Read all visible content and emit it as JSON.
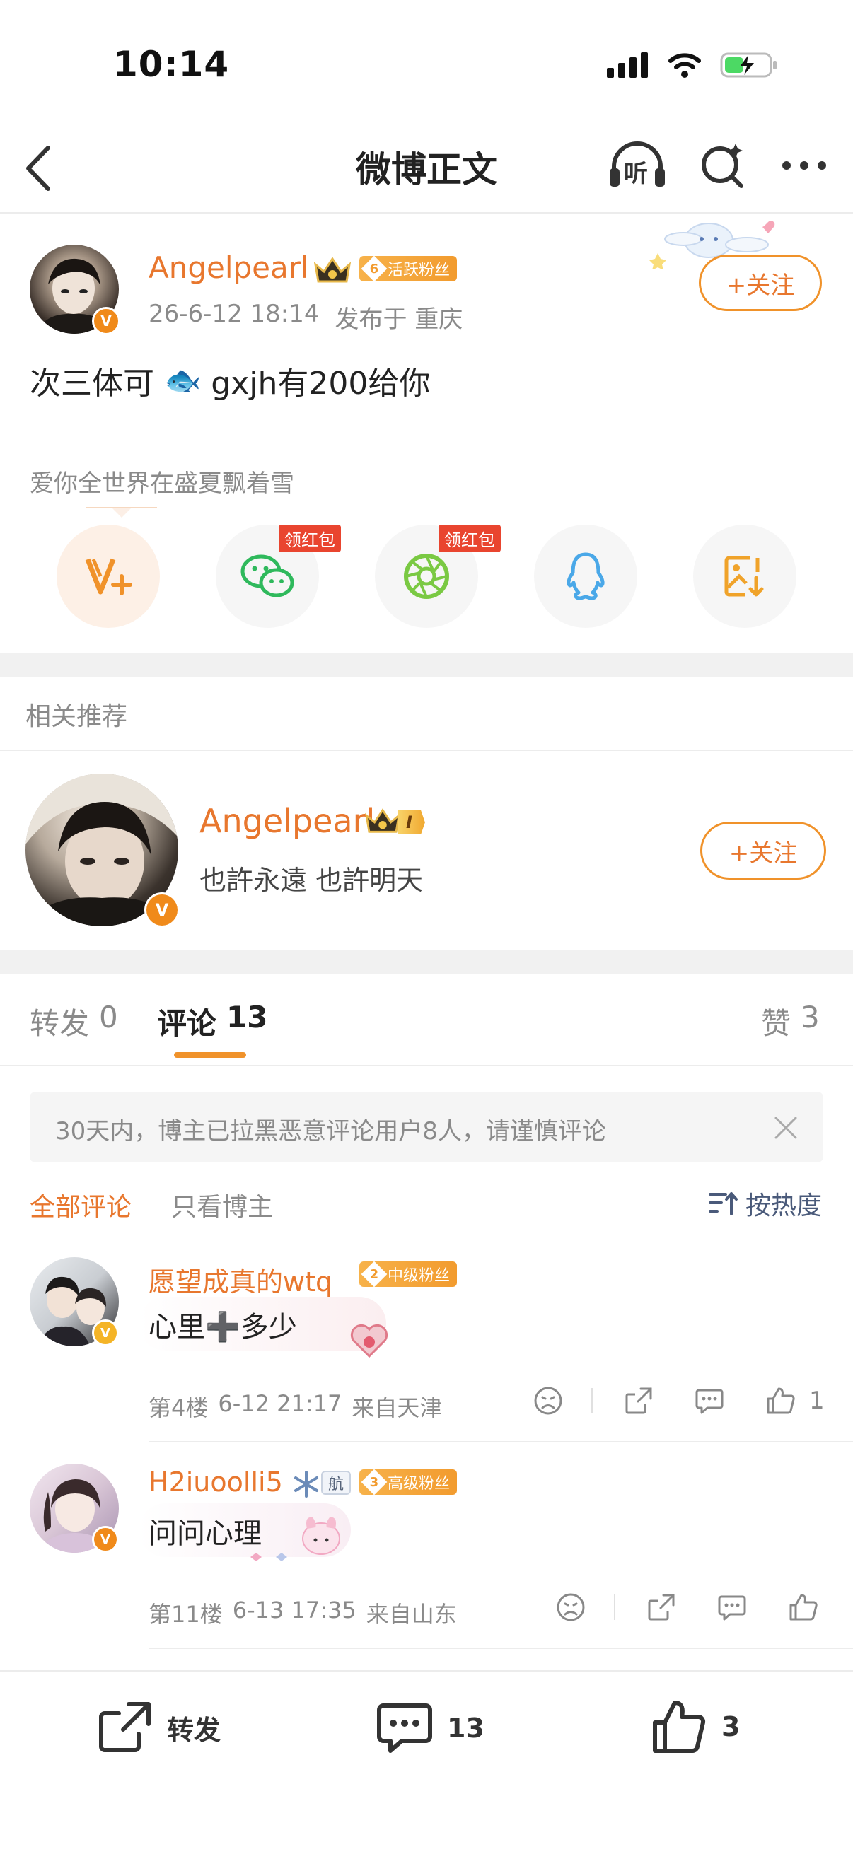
{
  "status": {
    "time": "10:14"
  },
  "nav": {
    "title": "微博正文",
    "listen_label": "听"
  },
  "post": {
    "author": "Angelpearl",
    "fan_badge_level": "6",
    "fan_badge_text": "活跃粉丝",
    "meta_time": "26-6-12 18:14",
    "meta_location": "发布于 重庆",
    "follow_label": "+关注",
    "text_before": "次三体可",
    "text_emoji": "🐟",
    "text_after": "gxjh有200给你",
    "signature": "爱你全世界在盛夏飘着雪"
  },
  "share": {
    "items": [
      {
        "name": "weibo-vplus",
        "tag": ""
      },
      {
        "name": "wechat",
        "tag": "领红包"
      },
      {
        "name": "moments",
        "tag": "领红包"
      },
      {
        "name": "qq",
        "tag": ""
      },
      {
        "name": "save-image",
        "tag": ""
      }
    ]
  },
  "recommend": {
    "section_title": "相关推荐",
    "name": "Angelpearl",
    "level": "I",
    "desc": "也許永遠 也許明天",
    "follow_label": "+关注"
  },
  "tabs": {
    "repost_label": "转发",
    "repost_count": "0",
    "comment_label": "评论",
    "comment_count": "13",
    "like_label": "赞",
    "like_count": "3"
  },
  "notice": {
    "text": "30天内，博主已拉黑恶意评论用户8人，请谨慎评论"
  },
  "filter": {
    "all": "全部评论",
    "author_only": "只看博主",
    "sort": "按热度"
  },
  "comments": [
    {
      "user": "愿望成真的wtq",
      "badge_level": "2",
      "badge_text": "中级粉丝",
      "text": "心里➕多少",
      "floor": "第4楼",
      "time": "6-12 21:17",
      "location": "来自天津",
      "likes": "1"
    },
    {
      "user": "H2iuoolli5",
      "extra_badge": "航",
      "badge_level": "3",
      "badge_text": "高级粉丝",
      "text": "问问心理",
      "floor": "第11楼",
      "time": "6-13 17:35",
      "location": "来自山东",
      "likes": ""
    }
  ],
  "bottom": {
    "repost_label": "转发",
    "comment_count": "13",
    "like_count": "3"
  },
  "colors": {
    "accent": "#e8772e",
    "fan_badge": "#f29b2e",
    "red_tag": "#e9452f",
    "verified": "#f08a1a"
  }
}
